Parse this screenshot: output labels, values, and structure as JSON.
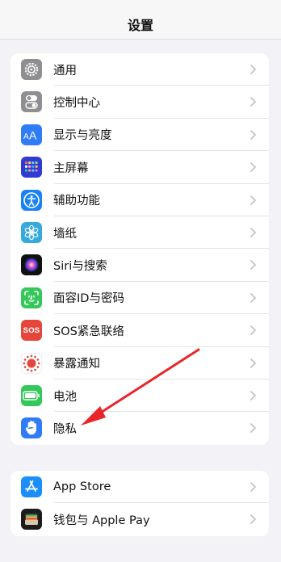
{
  "header": {
    "title": "设置"
  },
  "group1": [
    {
      "key": "general",
      "label": "通用",
      "icon": "gear-icon",
      "color": "#8e8e93"
    },
    {
      "key": "control-center",
      "label": "控制中心",
      "icon": "toggles-icon",
      "color": "#8e8e93"
    },
    {
      "key": "display",
      "label": "显示与亮度",
      "icon": "text-size-icon",
      "color": "#2f7cf6"
    },
    {
      "key": "home-screen",
      "label": "主屏幕",
      "icon": "app-grid-icon",
      "color": "#2f3bd3"
    },
    {
      "key": "accessibility",
      "label": "辅助功能",
      "icon": "accessibility-icon",
      "color": "#1a82f3"
    },
    {
      "key": "wallpaper",
      "label": "墙纸",
      "icon": "flower-icon",
      "color": "#36aadc"
    },
    {
      "key": "siri",
      "label": "Siri与搜索",
      "icon": "siri-icon",
      "color": "#111111"
    },
    {
      "key": "face-id",
      "label": "面容ID与密码",
      "icon": "face-id-icon",
      "color": "#34c759"
    },
    {
      "key": "sos",
      "label": "SOS紧急联络",
      "icon": "sos-icon",
      "color": "#e5453a",
      "icon_text": "SOS"
    },
    {
      "key": "exposure",
      "label": "暴露通知",
      "icon": "exposure-icon",
      "color": "#ffffff"
    },
    {
      "key": "battery",
      "label": "电池",
      "icon": "battery-icon",
      "color": "#34c759"
    },
    {
      "key": "privacy",
      "label": "隐私",
      "icon": "hand-icon",
      "color": "#2f7cf6"
    }
  ],
  "group2": [
    {
      "key": "app-store",
      "label": "App Store",
      "icon": "app-store-icon",
      "color": "#1c8ef9"
    },
    {
      "key": "wallet",
      "label": "钱包与 Apple Pay",
      "icon": "wallet-icon",
      "color": "#1c1c1e"
    }
  ],
  "annotation": {
    "arrow_color": "#e8262a"
  }
}
